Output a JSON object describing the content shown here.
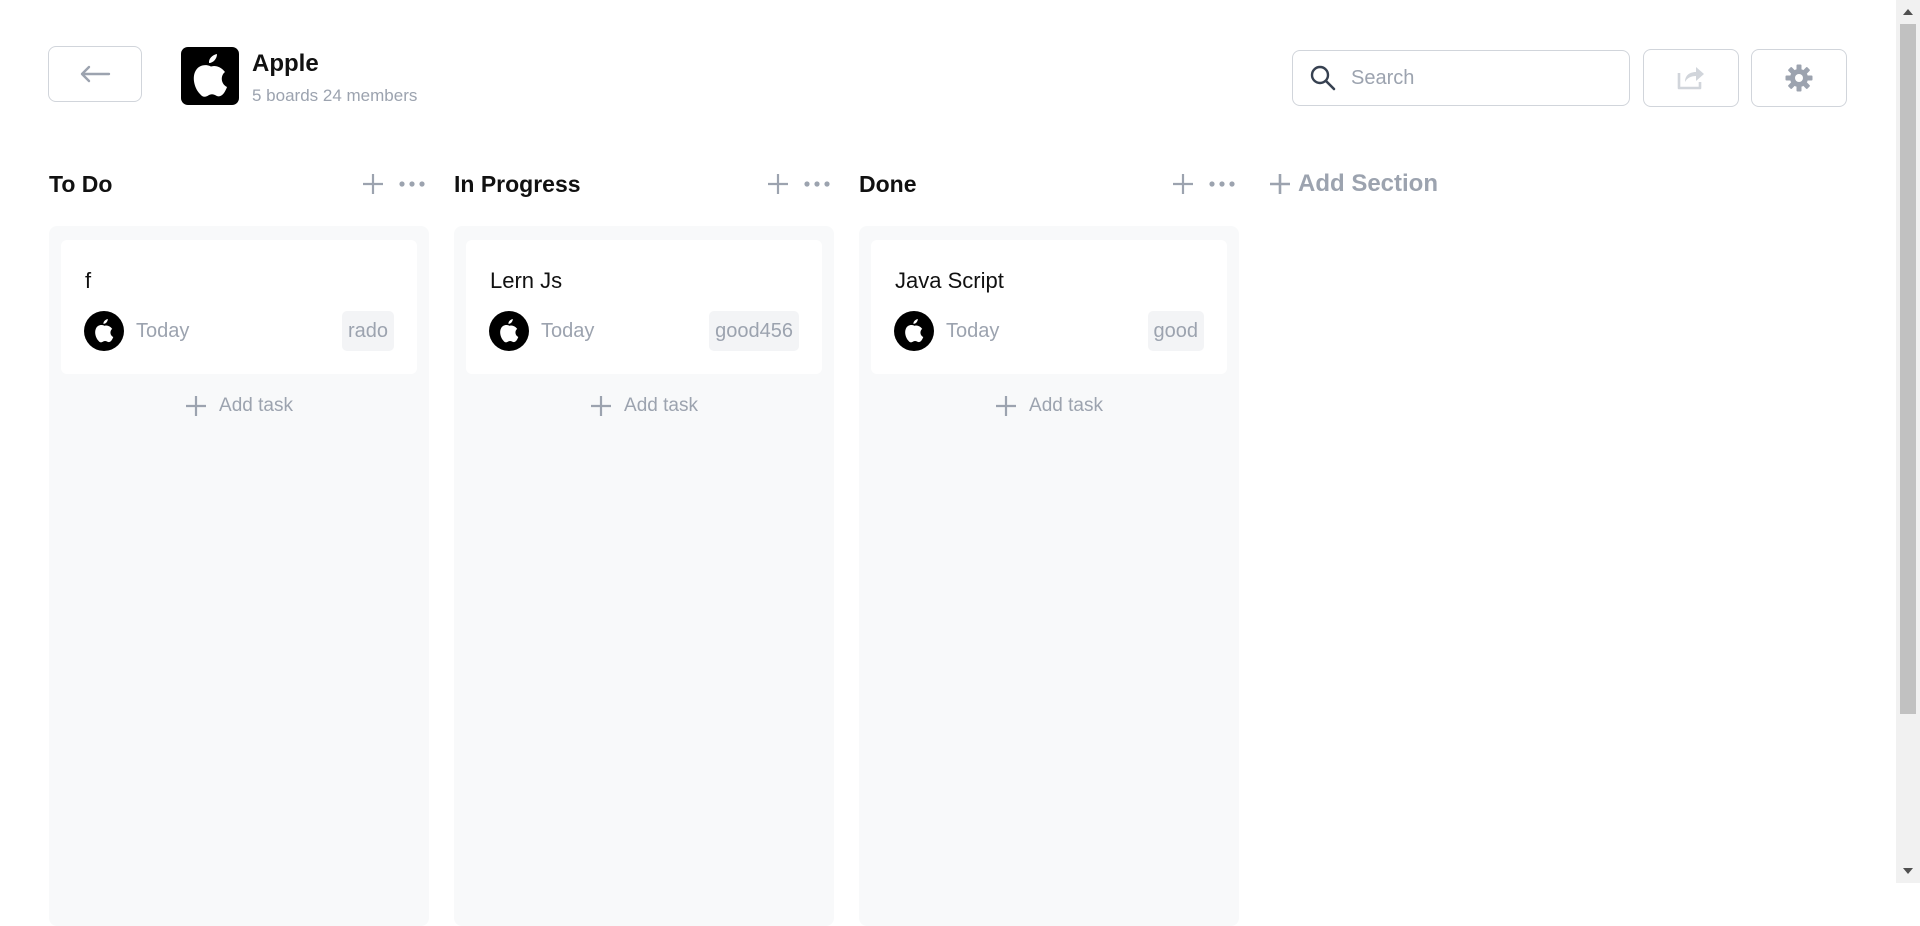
{
  "header": {
    "back_icon": "arrow-left-icon",
    "workspace": {
      "name": "Apple",
      "meta": "5 boards 24 members",
      "logo_icon": "apple-logo-icon"
    },
    "search": {
      "placeholder": "Search",
      "value": ""
    },
    "share_icon": "share-icon",
    "settings_icon": "gear-icon"
  },
  "sections": [
    {
      "title": "To Do",
      "task": {
        "title": "f",
        "date": "Today",
        "tag": "rado"
      },
      "add_task_label": "Add task"
    },
    {
      "title": "In Progress",
      "task": {
        "title": "Lern Js",
        "date": "Today",
        "tag": "good456"
      },
      "add_task_label": "Add task"
    },
    {
      "title": "Done",
      "task": {
        "title": "Java Script",
        "date": "Today",
        "tag": "good"
      },
      "add_task_label": "Add task"
    }
  ],
  "add_section_label": "Add Section",
  "colors": {
    "muted": "#9ca3af",
    "border": "#d1d5db",
    "column_bg": "#f8f9fa",
    "text": "#111111"
  }
}
